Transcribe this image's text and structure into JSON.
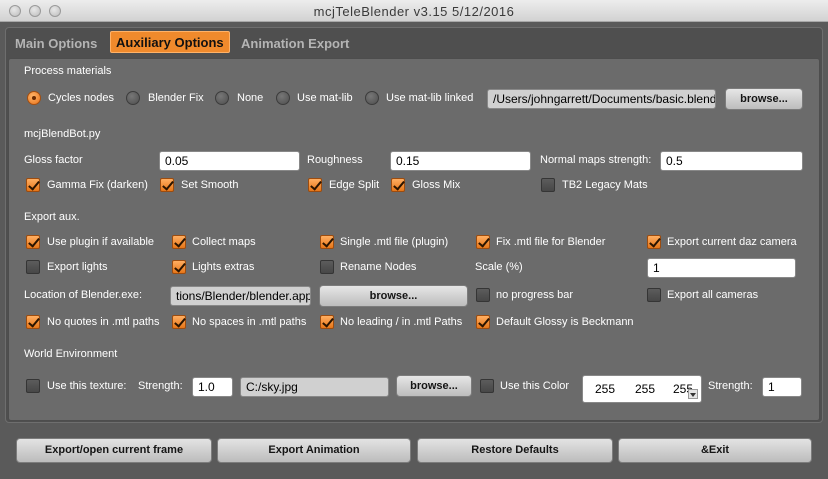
{
  "window": {
    "title": "mcjTeleBlender v3.15 5/12/2016"
  },
  "tabs": [
    {
      "label": "Main Options",
      "active": false
    },
    {
      "label": "Auxiliary Options",
      "active": true
    },
    {
      "label": "Animation Export",
      "active": false
    }
  ],
  "process": {
    "header": "Process materials",
    "options": [
      "Cycles nodes",
      "Blender Fix",
      "None",
      "Use mat-lib",
      "Use mat-lib linked"
    ],
    "selected": "Cycles nodes",
    "path": "/Users/johngarrett/Documents/basic.blend",
    "browse": "browse..."
  },
  "blendbot": {
    "header": "mcjBlendBot.py",
    "gloss_label": "Gloss factor",
    "gloss_value": "0.05",
    "rough_label": "Roughness",
    "rough_value": "0.15",
    "normal_label": "Normal maps strength:",
    "normal_value": "0.5",
    "checks": [
      {
        "label": "Gamma Fix (darken)",
        "checked": true
      },
      {
        "label": "Set Smooth",
        "checked": true
      },
      {
        "label": "Edge Split",
        "checked": true
      },
      {
        "label": "Gloss Mix",
        "checked": true
      },
      {
        "label": "TB2 Legacy Mats",
        "checked": false
      }
    ]
  },
  "export": {
    "header": "Export aux.",
    "row1": [
      {
        "label": "Use plugin if available",
        "checked": true
      },
      {
        "label": "Collect maps",
        "checked": true
      },
      {
        "label": "Single .mtl file (plugin)",
        "checked": true
      },
      {
        "label": "Fix .mtl file for Blender",
        "checked": true
      },
      {
        "label": "Export current daz camera",
        "checked": true
      }
    ],
    "row2": [
      {
        "label": "Export lights",
        "checked": false
      },
      {
        "label": "Lights extras",
        "checked": true
      },
      {
        "label": "Rename Nodes",
        "checked": false
      }
    ],
    "scale_label": "Scale (%)",
    "scale_value": "1",
    "location_label": "Location of Blender.exe:",
    "location_value": "tions/Blender/blender.app",
    "location_browse": "browse...",
    "no_progress": {
      "label": "no progress bar",
      "checked": false
    },
    "export_all_cams": {
      "label": "Export all cameras",
      "checked": false
    },
    "row4": [
      {
        "label": "No quotes in .mtl paths",
        "checked": true
      },
      {
        "label": "No spaces in .mtl paths",
        "checked": true
      },
      {
        "label": "No leading / in .mtl Paths",
        "checked": true
      },
      {
        "label": "Default Glossy is Beckmann",
        "checked": true
      }
    ]
  },
  "world": {
    "header": "World Environment",
    "use_texture": {
      "label": "Use this texture:",
      "checked": false
    },
    "strength_label": "Strength:",
    "strength_value": "1.0",
    "texture_path": "C:/sky.jpg",
    "browse": "browse...",
    "use_color": {
      "label": "Use this Color",
      "checked": false
    },
    "color": {
      "r": "255",
      "g": "255",
      "b": "255"
    },
    "color_strength_label": "Strength:",
    "color_strength_value": "1"
  },
  "footer": {
    "export_frame": "Export/open current frame",
    "export_anim": "Export Animation",
    "restore": "Restore Defaults",
    "exit": "&Exit"
  },
  "colors": {
    "accent": "#f08a2c",
    "panel": "#6b6b6b",
    "background": "#5a5a5a"
  }
}
